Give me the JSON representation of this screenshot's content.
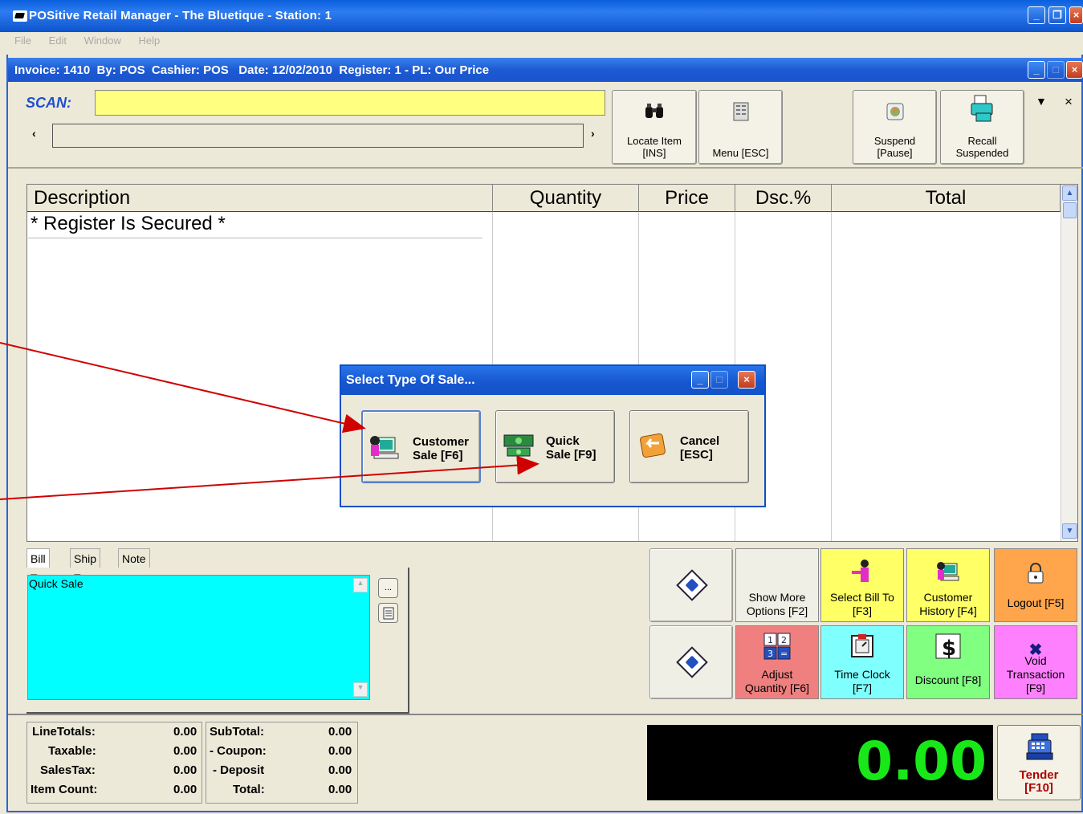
{
  "window": {
    "title": "POSitive Retail Manager - The Bluetique - Station: 1"
  },
  "menu": [
    "File",
    "Edit",
    "Window",
    "Help"
  ],
  "invoice_bar": "Invoice: 1410  By: POS  Cashier: POS   Date: 12/02/2010  Register: 1 - PL: Our Price",
  "scan": {
    "label": "SCAN:",
    "value": "",
    "prev": "‹",
    "next": "›"
  },
  "toolbar": {
    "locate": "Locate Item\n[INS]",
    "menu": "Menu [ESC]",
    "suspend": "Suspend\n[Pause]",
    "recall": "Recall\nSuspended"
  },
  "grid": {
    "columns": [
      "Description",
      "Quantity",
      "Price",
      "Dsc.%",
      "Total"
    ],
    "rows": [
      "* Register Is Secured *"
    ]
  },
  "dialog": {
    "title": "Select Type Of Sale...",
    "customer": "Customer\nSale [F6]",
    "quick": "Quick\nSale [F9]",
    "cancel": "Cancel\n[ESC]"
  },
  "tabs": [
    "Bill To",
    "Ship To",
    "Note"
  ],
  "bill_to": {
    "text": "Quick Sale",
    "browse": "..."
  },
  "actions": {
    "show_more": "Show More\nOptions [F2]",
    "select_bill": "Select Bill To\n[F3]",
    "customer_history": "Customer\nHistory [F4]",
    "logout": "Logout [F5]",
    "adjust_qty": "Adjust\nQuantity [F6]",
    "time_clock": "Time Clock\n[F7]",
    "discount": "Discount [F8]",
    "void": "Void\nTransaction\n[F9]"
  },
  "colors": {
    "select_bill": "#ffff66",
    "customer_history": "#ffff66",
    "logout": "#ffa64d",
    "adjust_qty": "#f08080",
    "time_clock": "#80ffff",
    "discount": "#80ff80",
    "void": "#ff80ff"
  },
  "totals": {
    "left": [
      {
        "label": "LineTotals:",
        "value": "0.00"
      },
      {
        "label": "Taxable:",
        "value": "0.00"
      },
      {
        "label": "SalesTax:",
        "value": "0.00"
      },
      {
        "label": "Item Count:",
        "value": "0.00"
      }
    ],
    "right": [
      {
        "label": "SubTotal:",
        "value": "0.00"
      },
      {
        "label": "- Coupon:",
        "value": "0.00"
      },
      {
        "label": "- Deposit",
        "value": "0.00"
      },
      {
        "label": "Total:",
        "value": "0.00"
      }
    ]
  },
  "display_amount": "0.00",
  "tender": "Tender\n[F10]"
}
